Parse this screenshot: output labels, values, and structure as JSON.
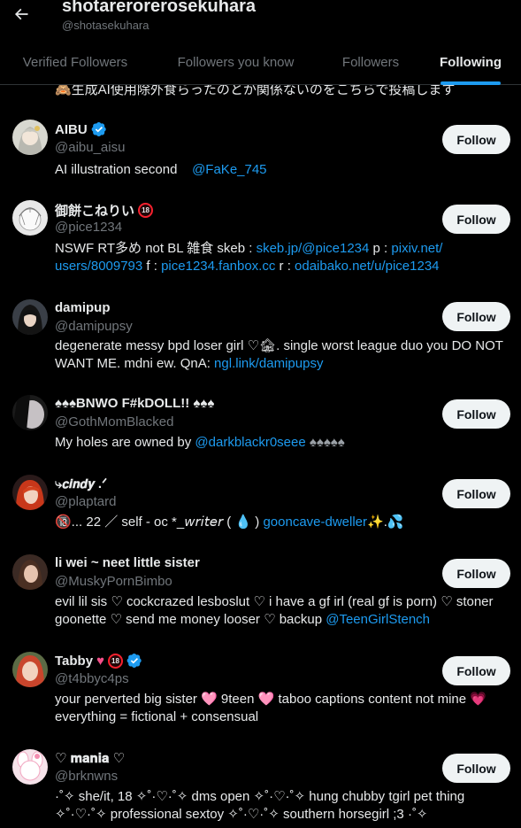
{
  "header": {
    "title": "shotarerorerosekuhara",
    "handle": "@shotasekuhara",
    "back_icon": "arrow-left-icon"
  },
  "tabs": [
    {
      "label": "Verified Followers",
      "active": false
    },
    {
      "label": "Followers you know",
      "active": false
    },
    {
      "label": "Followers",
      "active": false
    },
    {
      "label": "Following",
      "active": true
    }
  ],
  "partial_bio": "🙈生成AI使用除外食らったのとか関係ないのをこちらで投稿します",
  "follow_label": "Follow",
  "users": [
    {
      "name": "AIBU",
      "handle": "@aibu_aisu",
      "verified": true,
      "bio_text": "AI illustration second",
      "bio_link": "@FaKe_745"
    },
    {
      "name": "御餅こねりい",
      "handle": "@pice1234",
      "age_badge": "18",
      "bio_line1_prefix": "NSWF RT多め not BL 雑食 skeb : ",
      "bio_link1": "skeb.jp/@pice1234",
      "bio_mid1": " p : ",
      "bio_link2": "pixiv.net/",
      "bio_link2b": "users/8009793",
      "bio_mid2": " f : ",
      "bio_link3": "pice1234.fanbox.cc",
      "bio_mid3": " r : ",
      "bio_link4": "odaibako.net/u/pice1234"
    },
    {
      "name": "damipup",
      "handle": "@damipupsy",
      "bio_text": "degenerate messy bpd loser girl ♡🏚. single worst league duo you DO NOT WANT ME. mdni ew. QnA: ",
      "bio_link": "ngl.link/damipupsy"
    },
    {
      "name": "♠♠♠BNWO F#kDOLL!! ♠♠♠",
      "handle": "@GothMomBlacked",
      "bio_text": "My holes are owned by ",
      "bio_link": "@darkblackr0seee",
      "bio_suffix": " ♠♠♠♠♠"
    },
    {
      "name": "⤷𝙘𝙞𝙣𝙙𝙮 .ᐟ",
      "handle": "@plaptard",
      "bio_text": "🔞... 22 ／ self - oc *_𝘸𝘳𝘪𝘵𝘦𝘳 ( 💧 ) ",
      "bio_link": "gooncave-dweller",
      "bio_suffix": "✨.💦"
    },
    {
      "name": "li wei ~ neet little sister",
      "handle": "@MuskyPornBimbo",
      "bio_text": "evil lil sis ♡ cockcrazed lesboslut ♡ i have a gf irl (real gf is porn) ♡ stoner goonette ♡ send me money looser ♡ backup ",
      "bio_link": "@TeenGirlStench"
    },
    {
      "name": "Tabby",
      "handle": "@t4bbyc4ps",
      "verified": true,
      "age_badge": "18",
      "bio_text": "your perverted big sister 🩷 9teen 🩷 taboo captions content not mine 💗 everything = fictional + consensual"
    },
    {
      "name": "♡ 𝐦𝐚𝐧𝐢𝐚 ♡",
      "handle": "@brknwns",
      "bio_text": "·˚✧ she/it, 18 ✧˚·♡·˚✧ dms open ✧˚·♡·˚✧ hung chubby tgirl pet thing ✧˚·♡·˚✧ professional sextoy ✧˚·♡·˚✧ southern horsegirl ;3 ·˚✧"
    }
  ],
  "colors": {
    "accent": "#1d9bf0",
    "background": "#000000",
    "muted": "#71767b",
    "text": "#e7e9ea"
  }
}
